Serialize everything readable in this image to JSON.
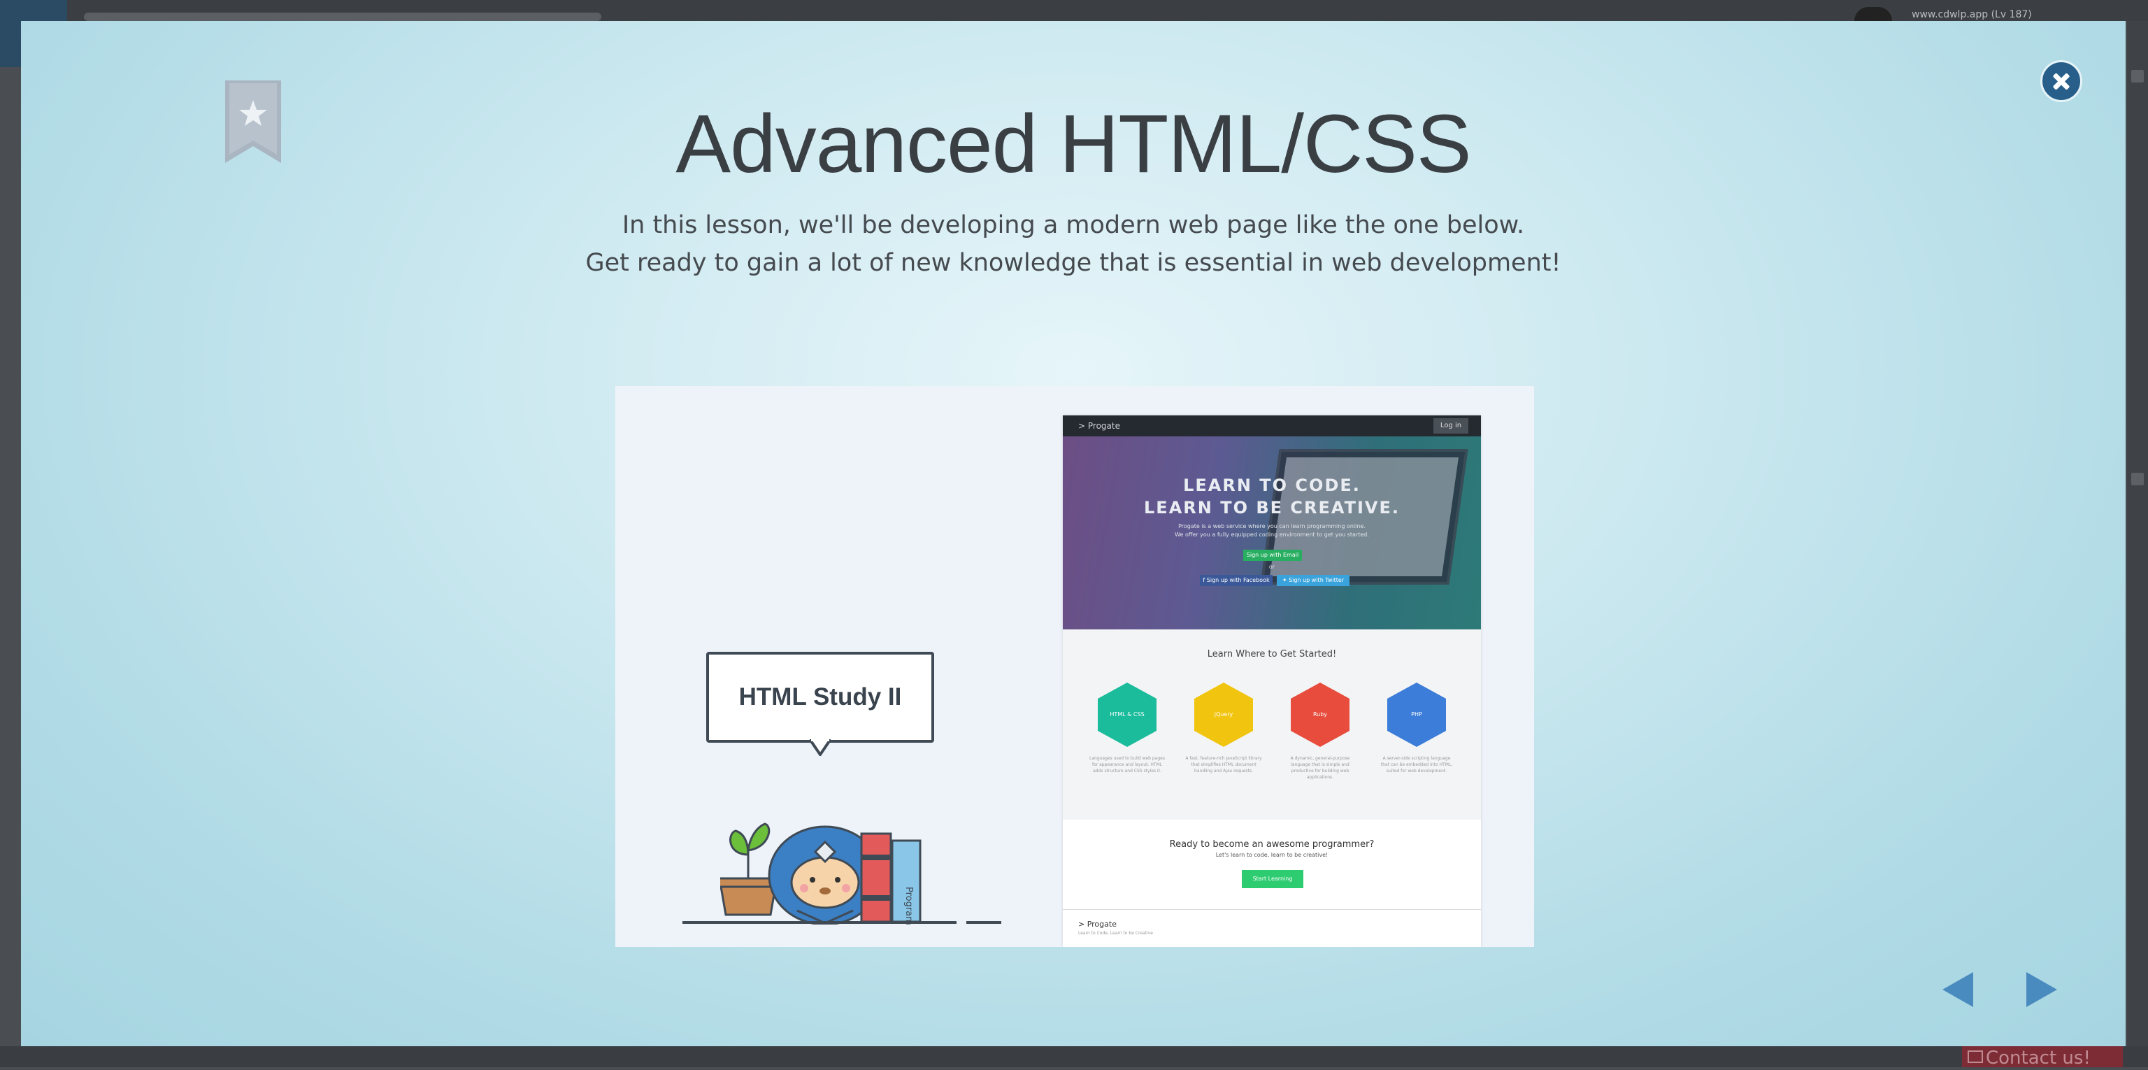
{
  "background": {
    "user_label": "www.cdwlp.app (Lv 187)",
    "contact_label": "Contact us!"
  },
  "modal": {
    "title": "Advanced HTML/CSS",
    "subtitle_line1": "In this lesson, we'll be developing a modern web page like the one below.",
    "subtitle_line2": "Get ready to gain a lot of new knowledge that is essential in web development!",
    "accent_color": "#275f8a"
  },
  "preview": {
    "bubble_text": "HTML Study II",
    "book_label": "Programming",
    "site": {
      "logo": "> Progate",
      "login_label": "Log in",
      "hero_line1": "LEARN TO CODE.",
      "hero_line2": "LEARN TO BE CREATIVE.",
      "hero_text1": "Progate is a web service where you can learn programming online.",
      "hero_text2": "We offer you a fully equipped coding environment to get you started.",
      "email_button": "Sign up with Email",
      "or_label": "or",
      "facebook_button": "f Sign up with Facebook",
      "twitter_button": "✦ Sign up with Twitter",
      "section_title": "Learn Where to Get Started!",
      "courses": [
        {
          "label": "HTML & CSS",
          "color": "#1abc9c",
          "desc": "Languages used to build web pages for appearance and layout. HTML adds structure and CSS styles it."
        },
        {
          "label": "jQuery",
          "color": "#f1c40f",
          "desc": "A fast, feature-rich JavaScript library that simplifies HTML document handling and Ajax requests."
        },
        {
          "label": "Ruby",
          "color": "#e74c3c",
          "desc": "A dynamic, general-purpose language that is simple and productive for building web applications."
        },
        {
          "label": "PHP",
          "color": "#3b7dd8",
          "desc": "A server-side scripting language that can be embedded into HTML, suited for web development."
        }
      ],
      "cta_title": "Ready to become an awesome programmer?",
      "cta_text": "Let's learn to code, learn to be creative!",
      "cta_button": "Start Learning",
      "footer_logo": "> Progate",
      "footer_text": "Learn to Code, Learn to be Creative"
    }
  }
}
